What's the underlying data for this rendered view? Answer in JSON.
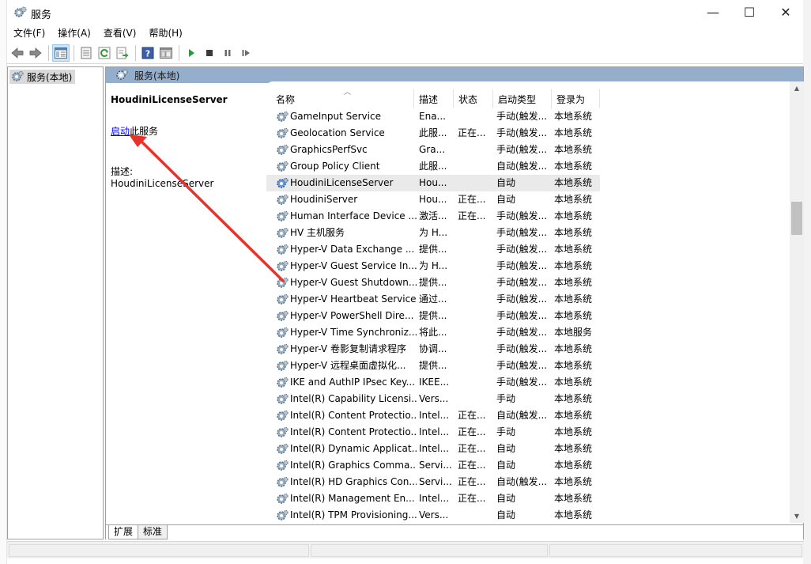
{
  "window": {
    "title": "服务",
    "minimize_symbol": "—",
    "maximize_symbol": "☐",
    "close_symbol": "✕"
  },
  "menu": [
    "文件(F)",
    "操作(A)",
    "查看(V)",
    "帮助(H)"
  ],
  "toolbar": {
    "icons": [
      "back-arrow-icon",
      "forward-arrow-icon",
      "show-tree-icon",
      "properties-icon",
      "refresh-icon",
      "export-list-icon",
      "help-icon",
      "console-icon",
      "start-service-icon",
      "stop-service-icon",
      "pause-service-icon",
      "restart-service-icon"
    ]
  },
  "tree": {
    "root_label": "服务(本地)"
  },
  "main": {
    "header_title": "服务(本地)",
    "selected_service": "HoudiniLicenseServer",
    "start_link": "启动",
    "start_suffix": "此服务",
    "desc_label": "描述:",
    "desc_value": "HoudiniLicenseServer"
  },
  "list": {
    "columns": [
      "名称",
      "描述",
      "状态",
      "启动类型",
      "登录为"
    ],
    "rows": [
      [
        "GameInput Service",
        "Ena...",
        "",
        "手动(触发...",
        "本地系统"
      ],
      [
        "Geolocation Service",
        "此服...",
        "正在...",
        "手动(触发...",
        "本地系统"
      ],
      [
        "GraphicsPerfSvc",
        "Gra...",
        "",
        "手动(触发...",
        "本地系统"
      ],
      [
        "Group Policy Client",
        "此服...",
        "",
        "自动(触发...",
        "本地系统"
      ],
      [
        "HoudiniLicenseServer",
        "Hou...",
        "",
        "自动",
        "本地系统"
      ],
      [
        "HoudiniServer",
        "Hou...",
        "正在...",
        "自动",
        "本地系统"
      ],
      [
        "Human Interface Device ...",
        "激活...",
        "正在...",
        "手动(触发...",
        "本地系统"
      ],
      [
        "HV 主机服务",
        "为 H...",
        "",
        "手动(触发...",
        "本地系统"
      ],
      [
        "Hyper-V Data Exchange ...",
        "提供...",
        "",
        "手动(触发...",
        "本地系统"
      ],
      [
        "Hyper-V Guest Service In...",
        "为 H...",
        "",
        "手动(触发...",
        "本地系统"
      ],
      [
        "Hyper-V Guest Shutdown...",
        "提供...",
        "",
        "手动(触发...",
        "本地系统"
      ],
      [
        "Hyper-V Heartbeat Service",
        "通过...",
        "",
        "手动(触发...",
        "本地系统"
      ],
      [
        "Hyper-V PowerShell Dire...",
        "提供...",
        "",
        "手动(触发...",
        "本地系统"
      ],
      [
        "Hyper-V Time Synchroniz...",
        "将此...",
        "",
        "手动(触发...",
        "本地服务"
      ],
      [
        "Hyper-V 卷影复制请求程序",
        "协调...",
        "",
        "手动(触发...",
        "本地系统"
      ],
      [
        "Hyper-V 远程桌面虚拟化...",
        "提供...",
        "",
        "手动(触发...",
        "本地系统"
      ],
      [
        "IKE and AuthIP IPsec Key...",
        "IKEE...",
        "",
        "手动(触发...",
        "本地系统"
      ],
      [
        "Intel(R) Capability Licensi...",
        "Vers...",
        "",
        "手动",
        "本地系统"
      ],
      [
        "Intel(R) Content Protectio...",
        "Intel...",
        "正在...",
        "自动(触发...",
        "本地系统"
      ],
      [
        "Intel(R) Content Protectio...",
        "Intel...",
        "正在...",
        "手动",
        "本地系统"
      ],
      [
        "Intel(R) Dynamic Applicat...",
        "Intel...",
        "正在...",
        "自动",
        "本地系统"
      ],
      [
        "Intel(R) Graphics Comma...",
        "Servi...",
        "正在...",
        "自动",
        "本地系统"
      ],
      [
        "Intel(R) HD Graphics Con...",
        "Servi...",
        "正在...",
        "自动(触发...",
        "本地系统"
      ],
      [
        "Intel(R) Management En...",
        "Intel...",
        "正在...",
        "自动",
        "本地系统"
      ],
      [
        "Intel(R) TPM Provisioning...",
        "Vers...",
        "",
        "自动",
        "本地系统"
      ]
    ],
    "selected_index": 4
  },
  "tabs": [
    "扩展",
    "标准"
  ],
  "colors": {
    "header_bg": "#95aecb",
    "link": "#0000ee",
    "annotation_arrow": "#e8332a",
    "selected_row": "#eaeaea"
  }
}
